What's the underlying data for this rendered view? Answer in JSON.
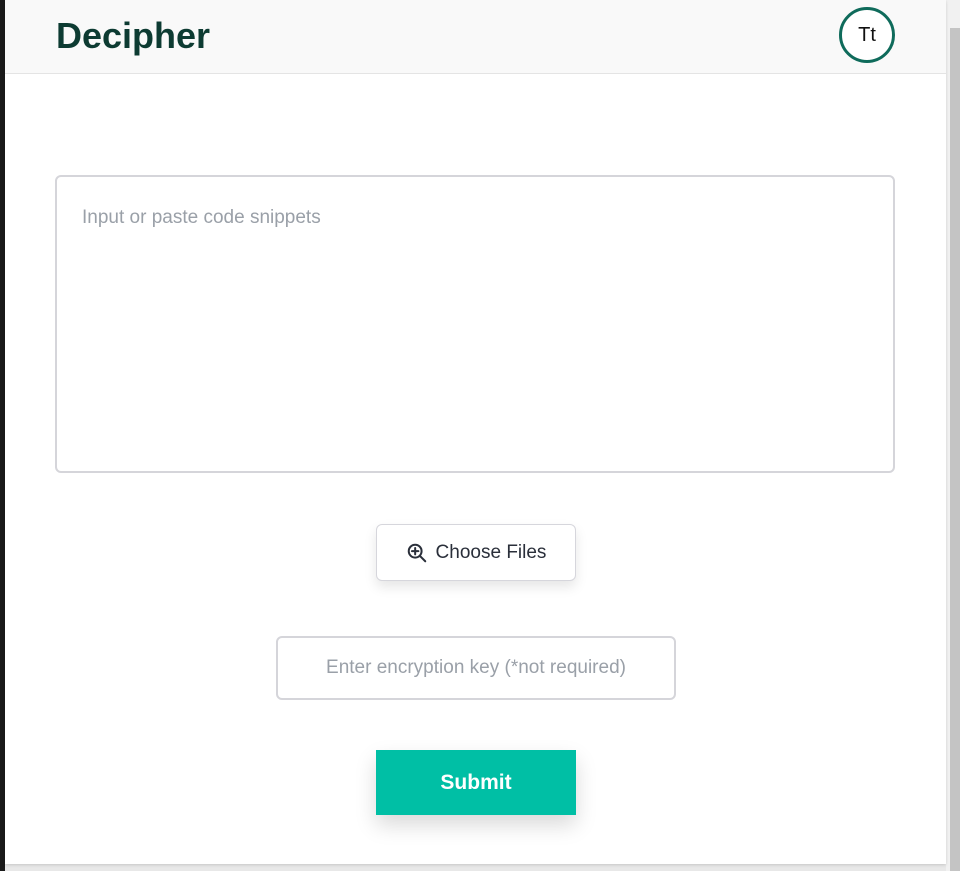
{
  "header": {
    "app_title": "Decipher",
    "avatar_initials": "Tt"
  },
  "main": {
    "code_input": {
      "value": "",
      "placeholder": "Input or paste code snippets"
    },
    "choose_files": {
      "label": "Choose Files",
      "icon": "zoom-in-icon"
    },
    "encryption_key": {
      "value": "",
      "placeholder": "Enter encryption key (*not required)"
    },
    "submit_label": "Submit"
  },
  "colors": {
    "accent": "#00bfa5",
    "title": "#0d3b32",
    "avatar_ring": "#0f6b5b"
  }
}
